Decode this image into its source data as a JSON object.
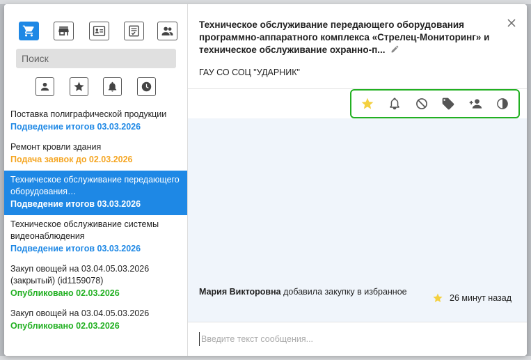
{
  "colors": {
    "accent": "#1e88e5",
    "toolbar_outline": "#22b022",
    "status_blue": "#1e88e5",
    "status_orange": "#f5a623",
    "status_green": "#22b022",
    "star": "#f4d03f"
  },
  "categories": [
    {
      "icon": "cart-icon",
      "active": true
    },
    {
      "icon": "store-icon",
      "active": false
    },
    {
      "icon": "contact-card-icon",
      "active": false
    },
    {
      "icon": "checklist-icon",
      "active": false
    },
    {
      "icon": "people-icon",
      "active": false
    }
  ],
  "search": {
    "placeholder": "Поиск"
  },
  "filters": [
    {
      "icon": "person-icon"
    },
    {
      "icon": "star-icon"
    },
    {
      "icon": "bell-icon"
    },
    {
      "icon": "clock-icon"
    }
  ],
  "list": [
    {
      "title": "Поставка полиграфической продукции",
      "status": "Подведение итогов 03.03.2026",
      "status_color": "#1e88e5",
      "selected": false
    },
    {
      "title": "Ремонт кровли здания",
      "status": "Подача заявок до 02.03.2026",
      "status_color": "#f5a623",
      "selected": false
    },
    {
      "title": "Техническое обслуживание передающего оборудования…",
      "status": "Подведение итогов 03.03.2026",
      "status_color": "#ffffff",
      "selected": true
    },
    {
      "title": "Техническое обслуживание системы видеонаблюдения",
      "status": "Подведение итогов 03.03.2026",
      "status_color": "#1e88e5",
      "selected": false
    },
    {
      "title": "Закуп овощей на 03.04.05.03.2026 (закрытый) (id1159078)",
      "status": "Опубликовано 02.03.2026",
      "status_color": "#22b022",
      "selected": false
    },
    {
      "title": "Закуп овощей на 03.04.05.03.2026",
      "status": "Опубликовано 02.03.2026",
      "status_color": "#22b022",
      "selected": false
    }
  ],
  "detail": {
    "title": "Техническое обслуживание передающего оборудования программно-аппаратного комплекса «Стрелец-Мониторинг» и техническое обслуживание охранно-п...",
    "organization": "ГАУ СО СОЦ \"УДАРНИК\""
  },
  "toolbar": [
    {
      "icon": "star-icon"
    },
    {
      "icon": "bell-icon"
    },
    {
      "icon": "block-icon"
    },
    {
      "icon": "tag-icon"
    },
    {
      "icon": "add-person-icon"
    },
    {
      "icon": "contrast-icon"
    }
  ],
  "message": {
    "author": "Мария Викторовна",
    "text": " добавила закупку в избранное",
    "time": "26 минут назад"
  },
  "composer": {
    "placeholder": "Введите текст сообщения..."
  }
}
